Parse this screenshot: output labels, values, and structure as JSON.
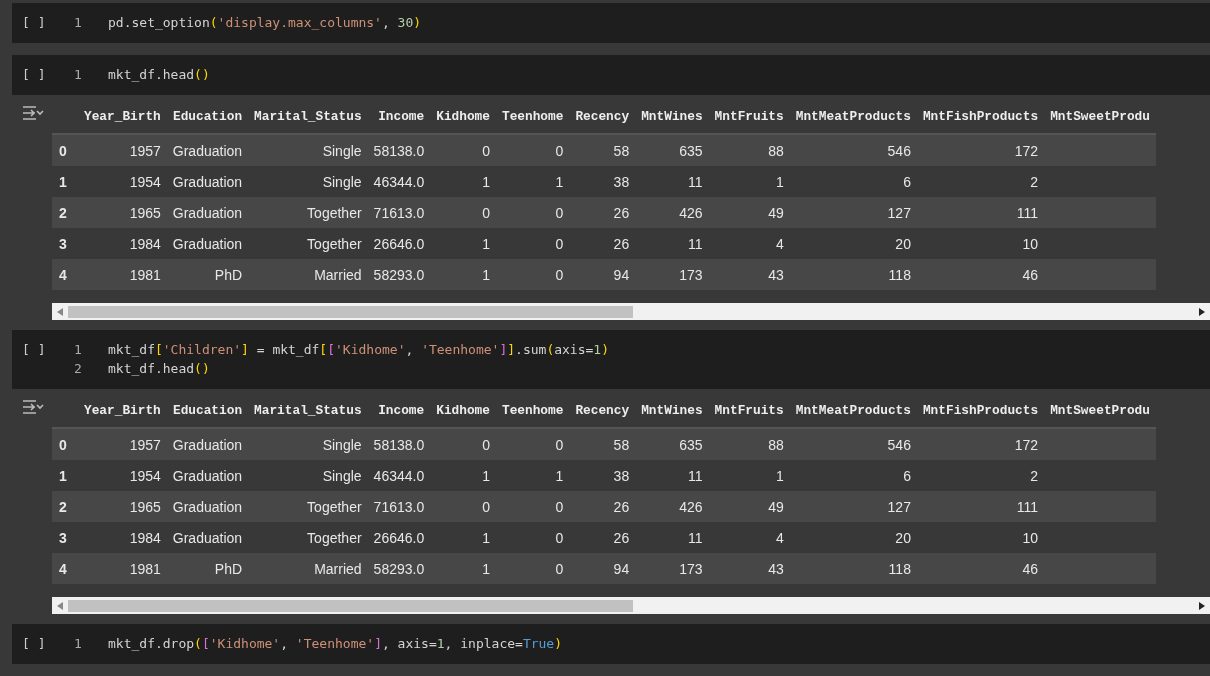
{
  "cells": [
    {
      "run_label": "[ ]",
      "lines": [
        {
          "number": "1",
          "tokens": [
            {
              "text": "pd.set_option",
              "kind": "plain"
            },
            {
              "text": "(",
              "kind": "paren"
            },
            {
              "text": "'display.max_columns'",
              "kind": "string"
            },
            {
              "text": ", ",
              "kind": "plain"
            },
            {
              "text": "30",
              "kind": "number"
            },
            {
              "text": ")",
              "kind": "paren"
            }
          ]
        }
      ]
    },
    {
      "run_label": "[ ]",
      "lines": [
        {
          "number": "1",
          "tokens": [
            {
              "text": "mkt_df.head",
              "kind": "plain"
            },
            {
              "text": "()",
              "kind": "paren"
            }
          ]
        }
      ],
      "output": {
        "columns": [
          "Year_Birth",
          "Education",
          "Marital_Status",
          "Income",
          "Kidhome",
          "Teenhome",
          "Recency",
          "MntWines",
          "MntFruits",
          "MntMeatProducts",
          "MntFishProducts",
          "MntSweetProdu"
        ],
        "rows": [
          {
            "index": "0",
            "values": [
              "1957",
              "Graduation",
              "Single",
              "58138.0",
              "0",
              "0",
              "58",
              "635",
              "88",
              "546",
              "172"
            ]
          },
          {
            "index": "1",
            "values": [
              "1954",
              "Graduation",
              "Single",
              "46344.0",
              "1",
              "1",
              "38",
              "11",
              "1",
              "6",
              "2"
            ]
          },
          {
            "index": "2",
            "values": [
              "1965",
              "Graduation",
              "Together",
              "71613.0",
              "0",
              "0",
              "26",
              "426",
              "49",
              "127",
              "111"
            ]
          },
          {
            "index": "3",
            "values": [
              "1984",
              "Graduation",
              "Together",
              "26646.0",
              "1",
              "0",
              "26",
              "11",
              "4",
              "20",
              "10"
            ]
          },
          {
            "index": "4",
            "values": [
              "1981",
              "PhD",
              "Married",
              "58293.0",
              "1",
              "0",
              "94",
              "173",
              "43",
              "118",
              "46"
            ]
          }
        ]
      }
    },
    {
      "run_label": "[ ]",
      "lines": [
        {
          "number": "1",
          "tokens": [
            {
              "text": "mkt_df",
              "kind": "plain"
            },
            {
              "text": "[",
              "kind": "paren"
            },
            {
              "text": "'Children'",
              "kind": "string"
            },
            {
              "text": "]",
              "kind": "paren"
            },
            {
              "text": " = mkt_df",
              "kind": "plain"
            },
            {
              "text": "[",
              "kind": "paren"
            },
            {
              "text": "[",
              "kind": "bracket"
            },
            {
              "text": "'Kidhome'",
              "kind": "string"
            },
            {
              "text": ", ",
              "kind": "plain"
            },
            {
              "text": "'Teenhome'",
              "kind": "string"
            },
            {
              "text": "]",
              "kind": "bracket"
            },
            {
              "text": "]",
              "kind": "paren"
            },
            {
              "text": ".sum",
              "kind": "plain"
            },
            {
              "text": "(",
              "kind": "paren"
            },
            {
              "text": "axis=",
              "kind": "plain"
            },
            {
              "text": "1",
              "kind": "number"
            },
            {
              "text": ")",
              "kind": "paren"
            }
          ]
        },
        {
          "number": "2",
          "tokens": [
            {
              "text": "mkt_df.head",
              "kind": "plain"
            },
            {
              "text": "()",
              "kind": "paren"
            }
          ]
        }
      ],
      "output": {
        "columns": [
          "Year_Birth",
          "Education",
          "Marital_Status",
          "Income",
          "Kidhome",
          "Teenhome",
          "Recency",
          "MntWines",
          "MntFruits",
          "MntMeatProducts",
          "MntFishProducts",
          "MntSweetProdu"
        ],
        "rows": [
          {
            "index": "0",
            "values": [
              "1957",
              "Graduation",
              "Single",
              "58138.0",
              "0",
              "0",
              "58",
              "635",
              "88",
              "546",
              "172"
            ]
          },
          {
            "index": "1",
            "values": [
              "1954",
              "Graduation",
              "Single",
              "46344.0",
              "1",
              "1",
              "38",
              "11",
              "1",
              "6",
              "2"
            ]
          },
          {
            "index": "2",
            "values": [
              "1965",
              "Graduation",
              "Together",
              "71613.0",
              "0",
              "0",
              "26",
              "426",
              "49",
              "127",
              "111"
            ]
          },
          {
            "index": "3",
            "values": [
              "1984",
              "Graduation",
              "Together",
              "26646.0",
              "1",
              "0",
              "26",
              "11",
              "4",
              "20",
              "10"
            ]
          },
          {
            "index": "4",
            "values": [
              "1981",
              "PhD",
              "Married",
              "58293.0",
              "1",
              "0",
              "94",
              "173",
              "43",
              "118",
              "46"
            ]
          }
        ]
      }
    },
    {
      "run_label": "[ ]",
      "lines": [
        {
          "number": "1",
          "tokens": [
            {
              "text": "mkt_df.drop",
              "kind": "plain"
            },
            {
              "text": "(",
              "kind": "paren"
            },
            {
              "text": "[",
              "kind": "bracket"
            },
            {
              "text": "'Kidhome'",
              "kind": "string"
            },
            {
              "text": ", ",
              "kind": "plain"
            },
            {
              "text": "'Teenhome'",
              "kind": "string"
            },
            {
              "text": "]",
              "kind": "bracket"
            },
            {
              "text": ", axis=",
              "kind": "plain"
            },
            {
              "text": "1",
              "kind": "number"
            },
            {
              "text": ", inplace=",
              "kind": "plain"
            },
            {
              "text": "True",
              "kind": "constant"
            },
            {
              "text": ")",
              "kind": "paren"
            }
          ]
        }
      ]
    }
  ]
}
